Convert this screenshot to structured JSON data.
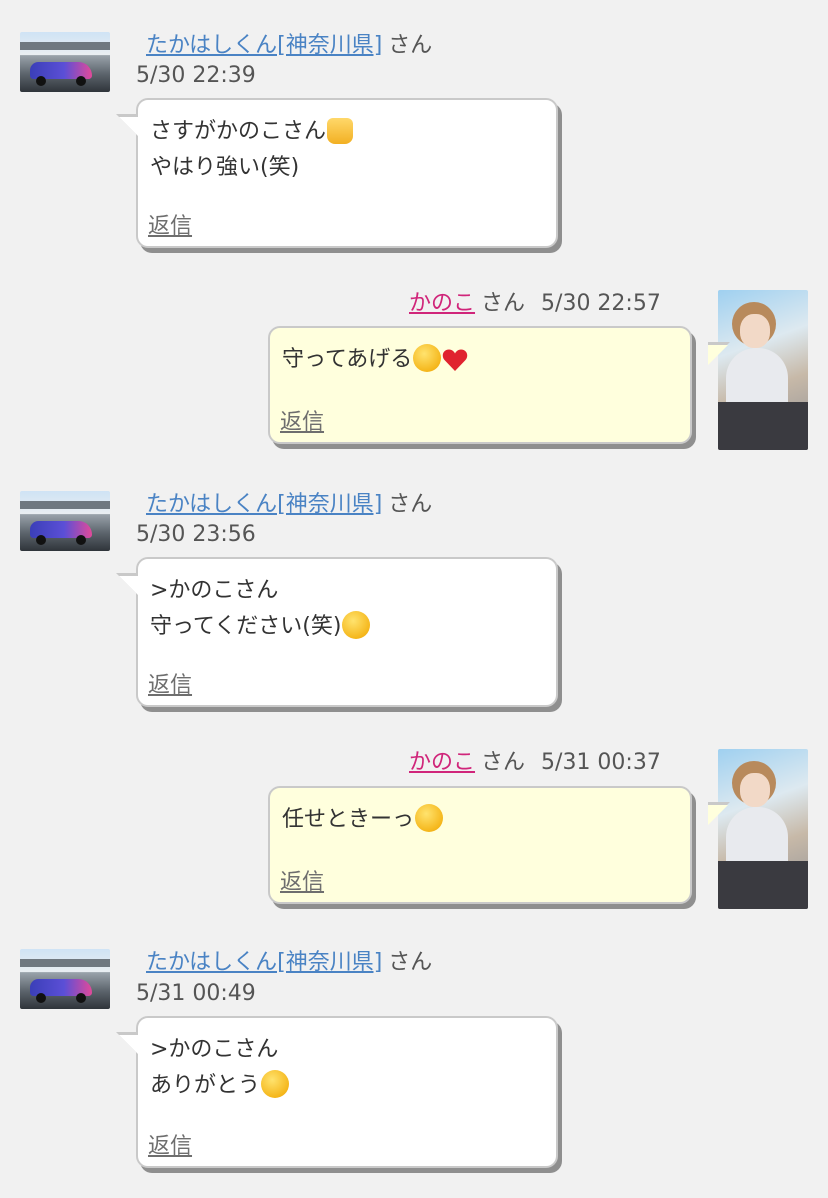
{
  "messages": [
    {
      "side": "left",
      "name": "たかはしくん[神奈川県]",
      "honorific": "さん",
      "timestamp": "5/30 22:39",
      "lines": [
        "さすがかのこさん",
        "やはり強い(笑)"
      ],
      "line_emojis": [
        "thumbs-up",
        ""
      ],
      "reply_label": "返信"
    },
    {
      "side": "right",
      "name": "かのこ",
      "honorific": "さん",
      "timestamp": "5/30 22:57",
      "lines": [
        "守ってあげる"
      ],
      "line_emojis": [
        "tears-of-joy+red-heart"
      ],
      "reply_label": "返信"
    },
    {
      "side": "left",
      "name": "たかはしくん[神奈川県]",
      "honorific": "さん",
      "timestamp": "5/30 23:56",
      "lines": [
        ">かのこさん",
        "守ってください(笑)"
      ],
      "line_emojis": [
        "",
        "grinning-squinting-face"
      ],
      "reply_label": "返信"
    },
    {
      "side": "right",
      "name": "かのこ",
      "honorific": "さん",
      "timestamp": "5/31 00:37",
      "lines": [
        "任せときーっ"
      ],
      "line_emojis": [
        "rolling-laughing-face"
      ],
      "reply_label": "返信"
    },
    {
      "side": "left",
      "name": "たかはしくん[神奈川県]",
      "honorific": "さん",
      "timestamp": "5/31 00:49",
      "lines": [
        ">かのこさん",
        "ありがとう"
      ],
      "line_emojis": [
        "",
        "heart-eyes-face"
      ],
      "reply_label": "返信"
    }
  ],
  "colors": {
    "background": "#f1f1f1",
    "left_name_link": "#4a83c4",
    "right_name_link": "#d0257a",
    "left_bubble": "#ffffff",
    "right_bubble": "#ffffdd"
  },
  "icons": {
    "left_avatar": "race-car-avatar",
    "right_avatar": "girl-photo-avatar"
  }
}
